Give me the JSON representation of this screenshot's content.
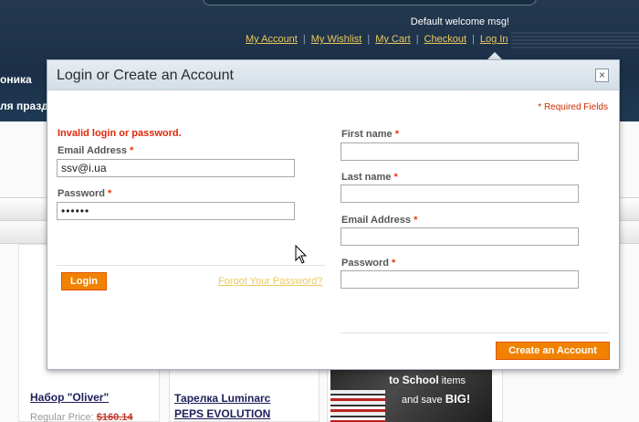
{
  "header": {
    "welcome": "Default welcome msg!",
    "links": [
      "My Account",
      "My Wishlist",
      "My Cart",
      "Checkout",
      "Log In"
    ],
    "nav_fragments": [
      "оника",
      "ля празд"
    ]
  },
  "products": [
    {
      "name": "Набор \"Oliver\"",
      "price_label": "Regular Price:",
      "price": "$160.14"
    },
    {
      "name": "Тарелка Luminarc PEPS EVOLUTION"
    }
  ],
  "banner": {
    "line1": "to School",
    "line1_rest": " items",
    "line2": "and save ",
    "line2_bold": "BIG!"
  },
  "modal": {
    "title": "Login or Create an Account",
    "close_glyph": "×",
    "required_note": "* Required Fields",
    "login": {
      "error": "Invalid login or password.",
      "email_label": "Email Address",
      "email_value": "ssv@i.ua",
      "password_label": "Password",
      "password_value": "••••••",
      "button": "Login",
      "forgot": "Forgot Your Password?"
    },
    "register": {
      "first_name_label": "First name",
      "last_name_label": "Last name",
      "email_label": "Email Address",
      "password_label": "Password",
      "button": "Create an Account"
    },
    "required_marker": "*"
  },
  "colors": {
    "header_bg": "#1b3047",
    "link": "#ecc85e",
    "accent_button": "#f18200",
    "error": "#df280a",
    "modal_header": "#dde6ee"
  },
  "icons": {
    "close": "close-icon",
    "cursor": "mouse-pointer-icon"
  }
}
